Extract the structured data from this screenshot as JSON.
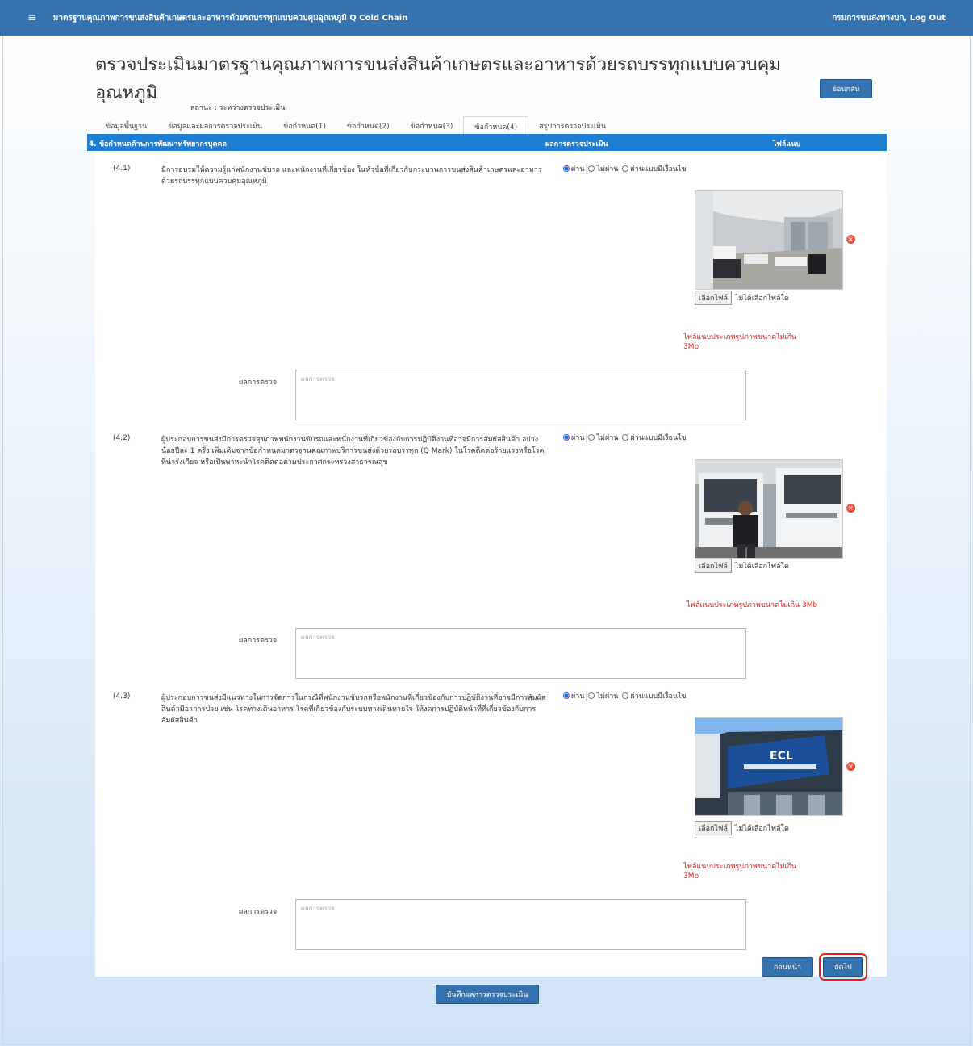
{
  "header": {
    "app_title": "มาตรฐานคุณภาพการขนส่งสินค้าเกษตรและอาหารด้วยรถบรรทุกแบบควบคุมอุณหภูมิ Q Cold Chain",
    "user": "กรมการขนส่งทางบก, Log Out",
    "menu_icon": "≡"
  },
  "page": {
    "title": "ตรวจประเมินมาตรฐานคุณภาพการขนส่งสินค้าเกษตรและอาหารด้วยรถบรรทุกแบบควบคุมอุณหภูมิ",
    "back_label": "ย้อนกลับ",
    "status": "สถานะ : ระหว่างตรวจประเมิน"
  },
  "tabs": [
    {
      "label": "ข้อมูลพื้นฐาน"
    },
    {
      "label": "ข้อมูลและผลการตรวจประเมิน"
    },
    {
      "label": "ข้อกำหนด(1)"
    },
    {
      "label": "ข้อกำหนด(2)"
    },
    {
      "label": "ข้อกำหนด(3)"
    },
    {
      "label": "ข้อกำหนด(4)",
      "active": true
    },
    {
      "label": "สรุปการตรวจประเมิน"
    }
  ],
  "section": {
    "title": "4. ข้อกำหนดด้านการพัฒนาทรัพยากรบุคคล",
    "col_result": "ผลการตรวจประเมิน",
    "col_file": "ไฟล์แนบ"
  },
  "radio_labels": [
    "ผ่าน",
    "ไม่ผ่าน",
    "ผ่านแบบมีเงื่อนไข"
  ],
  "items": [
    {
      "num": "(4.1)",
      "desc": "มีการอบรมให้ความรู้แก่พนักงานขับรถ และพนักงานที่เกี่ยวข้อง ในหัวข้อที่เกี่ยวกับกระบวนการขนส่งสินค้าเกษตรและอาหารด้วยรถบรรทุกแบบควบคุมอุณหภูมิ",
      "selected": "ผ่าน",
      "photo": "office-photo",
      "file_button": "เลือกไฟล์",
      "file_status": "ไม่ได้เลือกไฟล์ใด",
      "note": "ไฟล์แนบประเภทรูปภาพขนาดไม่เกิน 3Mb",
      "result_label": "ผลการตรวจ",
      "result_placeholder": "ผลการตรวจ"
    },
    {
      "num": "(4.2)",
      "desc": "ผู้ประกอบการขนส่งมีการตรวจสุขภาพพนักงานขับรถและพนักงานที่เกี่ยวข้องกับการปฏิบัติงานที่อาจมีการสัมผัสสินค้า อย่างน้อยปีละ 1 ครั้ง เพิ่มเติมจากข้อกำหนดมาตรฐานคุณภาพบริการขนส่งด้วยรถบรรทุก (Q Mark) ในโรคติดต่อร้ายแรงหรือโรคที่น่ารังเกียจ หรือเป็นพาหะนำโรคติดต่อตามประกาศกระทรวงสาธารณสุข",
      "selected": "ผ่าน",
      "photo": "truck-driver-photo",
      "file_button": "เลือกไฟล์",
      "file_status": "ไม่ได้เลือกไฟล์ใด",
      "note": "ไฟล์แนบประเภทรูปภาพขนาดไม่เกิน 3Mb",
      "result_label": "ผลการตรวจ",
      "result_placeholder": "ผลการตรวจ"
    },
    {
      "num": "(4.3)",
      "desc": "ผู้ประกอบการขนส่งมีแนวทางในการจัดการในกรณีที่พนักงานขับรถหรือพนักงานที่เกี่ยวข้องกับการปฏิบัติงานที่อาจมีการสัมผัสสินค้ามีอาการป่วย เช่น โรคทางเดินอาหาร โรคที่เกี่ยวข้องกับระบบทางเดินหายใจ ให้งดการปฏิบัติหน้าที่ที่เกี่ยวข้องกับการสัมผัสสินค้า",
      "selected": "ผ่าน",
      "photo": "building-photo",
      "file_button": "เลือกไฟล์",
      "file_status": "ไม่ได้เลือกไฟล์ใด",
      "note": "ไฟล์แนบประเภทรูปภาพขนาดไม่เกิน 3Mb",
      "result_label": "ผลการตรวจ",
      "result_placeholder": "ผลการตรวจ"
    }
  ],
  "buttons": {
    "prev": "ก่อนหน้า",
    "next": "ถัดไป",
    "save": "บันทึกผลการตรวจประเมิน"
  },
  "colors": {
    "topbar": "#3572b0",
    "section_header": "#1e7ed4",
    "button": "#3572b0",
    "note": "#e0201e",
    "highlight": "#e02020"
  },
  "photo_sign": "ECL"
}
